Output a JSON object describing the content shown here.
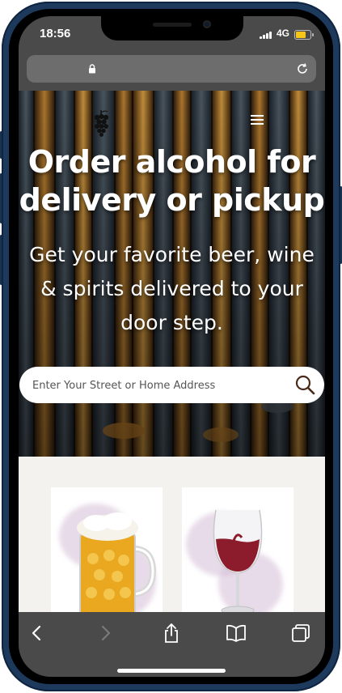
{
  "status_bar": {
    "time": "18:56",
    "network": "4G",
    "battery_level": 0.7
  },
  "browser": {
    "url_bar": {
      "lock_icon": "lock-icon",
      "reload_icon": "reload-icon"
    },
    "toolbar": {
      "back_icon": "chevron-left-icon",
      "forward_icon": "chevron-right-icon",
      "share_icon": "share-icon",
      "bookmarks_icon": "book-icon",
      "tabs_icon": "tabs-icon"
    }
  },
  "hero": {
    "logo_icon": "grapes-icon",
    "menu_icon": "hamburger-icon",
    "title": "Order alcohol for delivery or pickup",
    "subtitle": "Get your favorite beer, wine & spirits delivered to your door step.",
    "search": {
      "placeholder": "Enter Your Street or Home Address",
      "icon": "search-icon"
    }
  },
  "products": [
    {
      "item": "beer",
      "icon": "beer-mug-icon"
    },
    {
      "item": "wine",
      "icon": "wine-glass-icon"
    }
  ],
  "colors": {
    "phone_frame": "#1d3a5c",
    "browser_chrome": "#4a4a4a",
    "url_bar": "#6d6d6d",
    "products_bg": "#f3f2ef",
    "beer": "#e9a81f",
    "wine": "#8c1c2b"
  }
}
